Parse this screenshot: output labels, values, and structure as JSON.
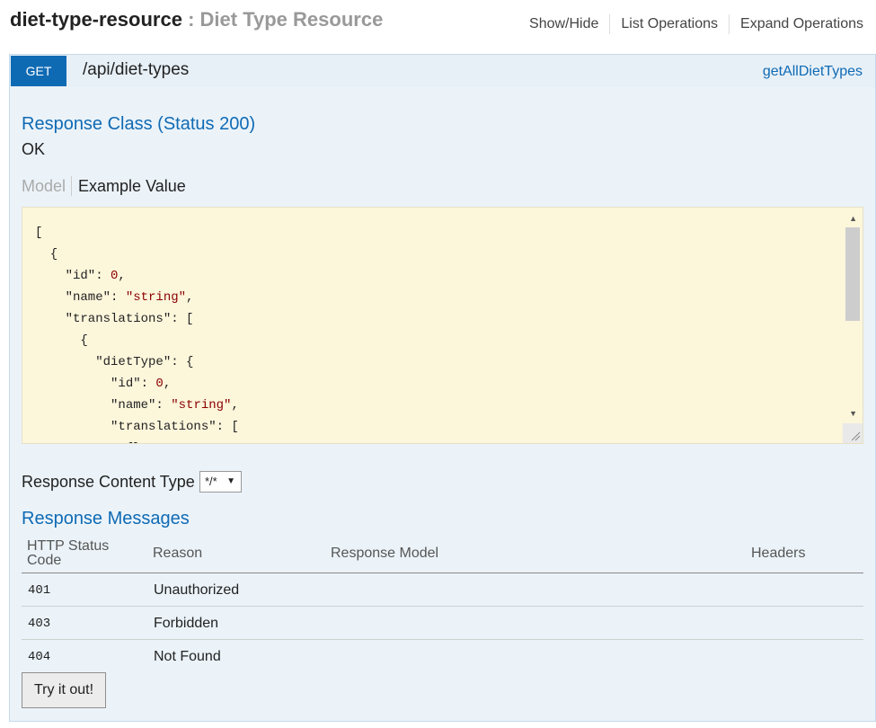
{
  "resource": {
    "name": "diet-type-resource",
    "separator": ":",
    "description": "Diet Type Resource",
    "links": [
      "Show/Hide",
      "List Operations",
      "Expand Operations"
    ]
  },
  "operation": {
    "method": "GET",
    "path": "/api/diet-types",
    "nickname": "getAllDietTypes"
  },
  "response_class": {
    "heading": "Response Class (Status 200)",
    "status_text": "OK",
    "tabs": {
      "model": "Model",
      "example": "Example Value"
    }
  },
  "example_json": [
    "[",
    "  {",
    "    \"id\": 0,",
    "    \"name\": \"string\",",
    "    \"translations\": [",
    "      {",
    "        \"dietType\": {",
    "          \"id\": 0,",
    "          \"name\": \"string\",",
    "          \"translations\": [",
    "            {}"
  ],
  "content_type": {
    "label": "Response Content Type",
    "selected": "*/*"
  },
  "response_messages": {
    "heading": "Response Messages",
    "columns": [
      "HTTP Status Code",
      "Reason",
      "Response Model",
      "Headers"
    ],
    "rows": [
      {
        "code": "401",
        "reason": "Unauthorized"
      },
      {
        "code": "403",
        "reason": "Forbidden"
      },
      {
        "code": "404",
        "reason": "Not Found"
      }
    ]
  },
  "try_button": "Try it out!",
  "colors": {
    "get_method": "#0f6ab4",
    "op_background": "#ebf3f9",
    "example_background": "#fcf6db"
  }
}
